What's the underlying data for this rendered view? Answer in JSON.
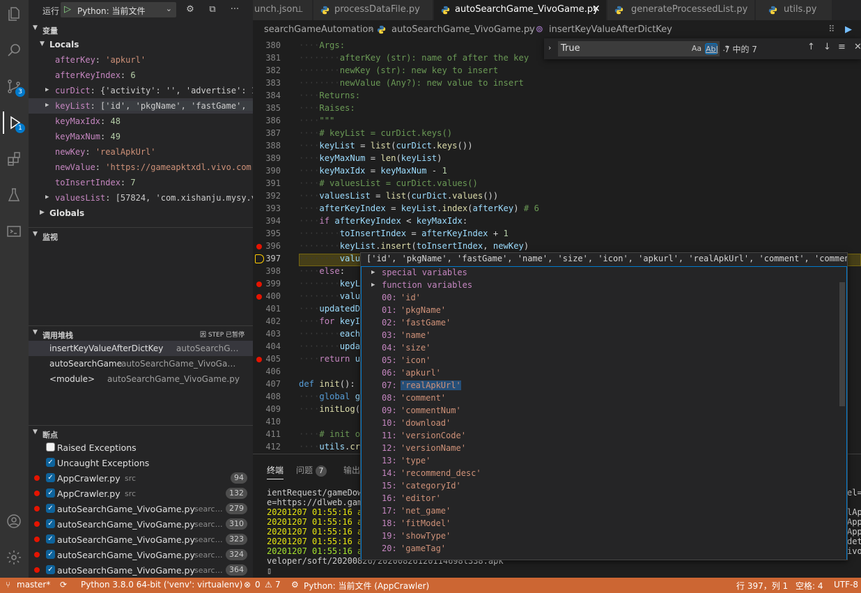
{
  "colors": {
    "accent": "#007acc",
    "status_bar": "#cc6633",
    "breakpoint": "#e51400"
  },
  "activity": {
    "scm_badge": "3",
    "debug_badge": "1"
  },
  "run": {
    "label": "运行",
    "config": "Python: 当前文件"
  },
  "variables": {
    "title": "变量",
    "locals_title": "Locals",
    "globals_title": "Globals",
    "items": [
      {
        "name": "afterKey",
        "value": "'apkurl'"
      },
      {
        "name": "afterKeyIndex",
        "value": "6"
      },
      {
        "name": "curDict",
        "value": "{'activity': '', 'advertise': 1, …"
      },
      {
        "name": "keyList",
        "value": "['id', 'pkgName', 'fastGame', 'na…"
      },
      {
        "name": "keyMaxIdx",
        "value": "48"
      },
      {
        "name": "keyMaxNum",
        "value": "49"
      },
      {
        "name": "newKey",
        "value": "'realApkUrl'"
      },
      {
        "name": "newValue",
        "value": "'https://gameapktxdl.vivo.com.cn…"
      },
      {
        "name": "toInsertIndex",
        "value": "7"
      },
      {
        "name": "valuesList",
        "value": "[57824, 'com.xishanju.mysy.viv…"
      }
    ]
  },
  "watch": {
    "title": "监视"
  },
  "callstack": {
    "title": "调用堆栈",
    "status": "因 STEP 已暂停",
    "frames": [
      {
        "fn": "insertKeyValueAfterDictKey",
        "src": "autoSearchG…"
      },
      {
        "fn": "autoSearchGame",
        "src": "autoSearchGame_VivoGa…"
      },
      {
        "fn": "<module>",
        "src": "autoSearchGame_VivoGame.py"
      }
    ]
  },
  "breakpoints": {
    "title": "断点",
    "raised": "Raised Exceptions",
    "uncaught": "Uncaught Exceptions",
    "items": [
      {
        "name": "AppCrawler.py",
        "path": "src",
        "line": "94"
      },
      {
        "name": "AppCrawler.py",
        "path": "src",
        "line": "132"
      },
      {
        "name": "autoSearchGame_VivoGame.py",
        "path": "searc…",
        "line": "279"
      },
      {
        "name": "autoSearchGame_VivoGame.py",
        "path": "searc…",
        "line": "310"
      },
      {
        "name": "autoSearchGame_VivoGame.py",
        "path": "searc…",
        "line": "323"
      },
      {
        "name": "autoSearchGame_VivoGame.py",
        "path": "searc…",
        "line": "324"
      },
      {
        "name": "autoSearchGame_VivoGame.py",
        "path": "searc…",
        "line": "364"
      }
    ]
  },
  "tabs": [
    {
      "label": "unch.json",
      "active": false
    },
    {
      "label": "processDataFile.py",
      "active": false
    },
    {
      "label": "autoSearchGame_VivoGame.py",
      "active": true
    },
    {
      "label": "generateProcessedList.py",
      "active": false
    },
    {
      "label": "utils.py",
      "active": false
    }
  ],
  "breadcrumb": {
    "folder": "searchGameAutomation",
    "file": "autoSearchGame_VivoGame.py",
    "symbol": "insertKeyValueAfterDictKey"
  },
  "find": {
    "value": "True",
    "opt_case": "Aa",
    "opt_word": "Ab|",
    "opt_regex": ".*",
    "result": "7 中的 7"
  },
  "editor": {
    "line_numbers": [
      "380",
      "381",
      "382",
      "383",
      "384",
      "385",
      "386",
      "387",
      "388",
      "389",
      "390",
      "391",
      "392",
      "393",
      "394",
      "395",
      "396",
      "397",
      "398",
      "399",
      "400",
      "401",
      "402",
      "403",
      "404",
      "405",
      "406",
      "407",
      "408",
      "409",
      "410",
      "411",
      "412"
    ],
    "current_line": "397"
  },
  "hover": {
    "header": "['id', 'pkgName', 'fastGame', 'name', 'size', 'icon', 'apkurl', 'realApkUrl', 'comment', 'commentNum',…",
    "groups": [
      "special variables",
      "function variables"
    ],
    "items": [
      {
        "idx": "00:",
        "val": "'id'"
      },
      {
        "idx": "01:",
        "val": "'pkgName'"
      },
      {
        "idx": "02:",
        "val": "'fastGame'"
      },
      {
        "idx": "03:",
        "val": "'name'"
      },
      {
        "idx": "04:",
        "val": "'size'"
      },
      {
        "idx": "05:",
        "val": "'icon'"
      },
      {
        "idx": "06:",
        "val": "'apkurl'"
      },
      {
        "idx": "07:",
        "val": "'realApkUrl'"
      },
      {
        "idx": "08:",
        "val": "'comment'"
      },
      {
        "idx": "09:",
        "val": "'commentNum'"
      },
      {
        "idx": "10:",
        "val": "'download'"
      },
      {
        "idx": "11:",
        "val": "'versionCode'"
      },
      {
        "idx": "12:",
        "val": "'versionName'"
      },
      {
        "idx": "13:",
        "val": "'type'"
      },
      {
        "idx": "14:",
        "val": "'recommend_desc'"
      },
      {
        "idx": "15:",
        "val": "'categoryId'"
      },
      {
        "idx": "16:",
        "val": "'editor'"
      },
      {
        "idx": "17:",
        "val": "'net_game'"
      },
      {
        "idx": "18:",
        "val": "'fitModel'"
      },
      {
        "idx": "19:",
        "val": "'showType'"
      },
      {
        "idx": "20:",
        "val": "'gameTag'"
      }
    ]
  },
  "panel": {
    "tabs": [
      {
        "label": "终端"
      },
      {
        "label": "问题",
        "count": "7"
      },
      {
        "label": "输出"
      }
    ],
    "lines": [
      "ientRequest/gameDow",
      "e=https://dlweb.gam",
      "20201207 01:55:16 a",
      "20201207 01:55:16 a",
      "20201207 01:55:16 a",
      "20201207 01:55:16 a",
      "20201207 01:55:16 a",
      "veloper/soft/20200826/20200826120114698l338.apk"
    ],
    "right_lines": [
      "el=",
      "",
      "lAp",
      "App",
      "App",
      "det",
      "ivo"
    ]
  },
  "status": {
    "branch": "master*",
    "python": "Python 3.8.0 64-bit ('venv': virtualenv)",
    "errors": "0",
    "warnings": "7",
    "debug": "Python: 当前文件 (AppCrawler)",
    "position": "行 397，列 1",
    "spaces": "空格: 4",
    "encoding": "UTF-8"
  }
}
